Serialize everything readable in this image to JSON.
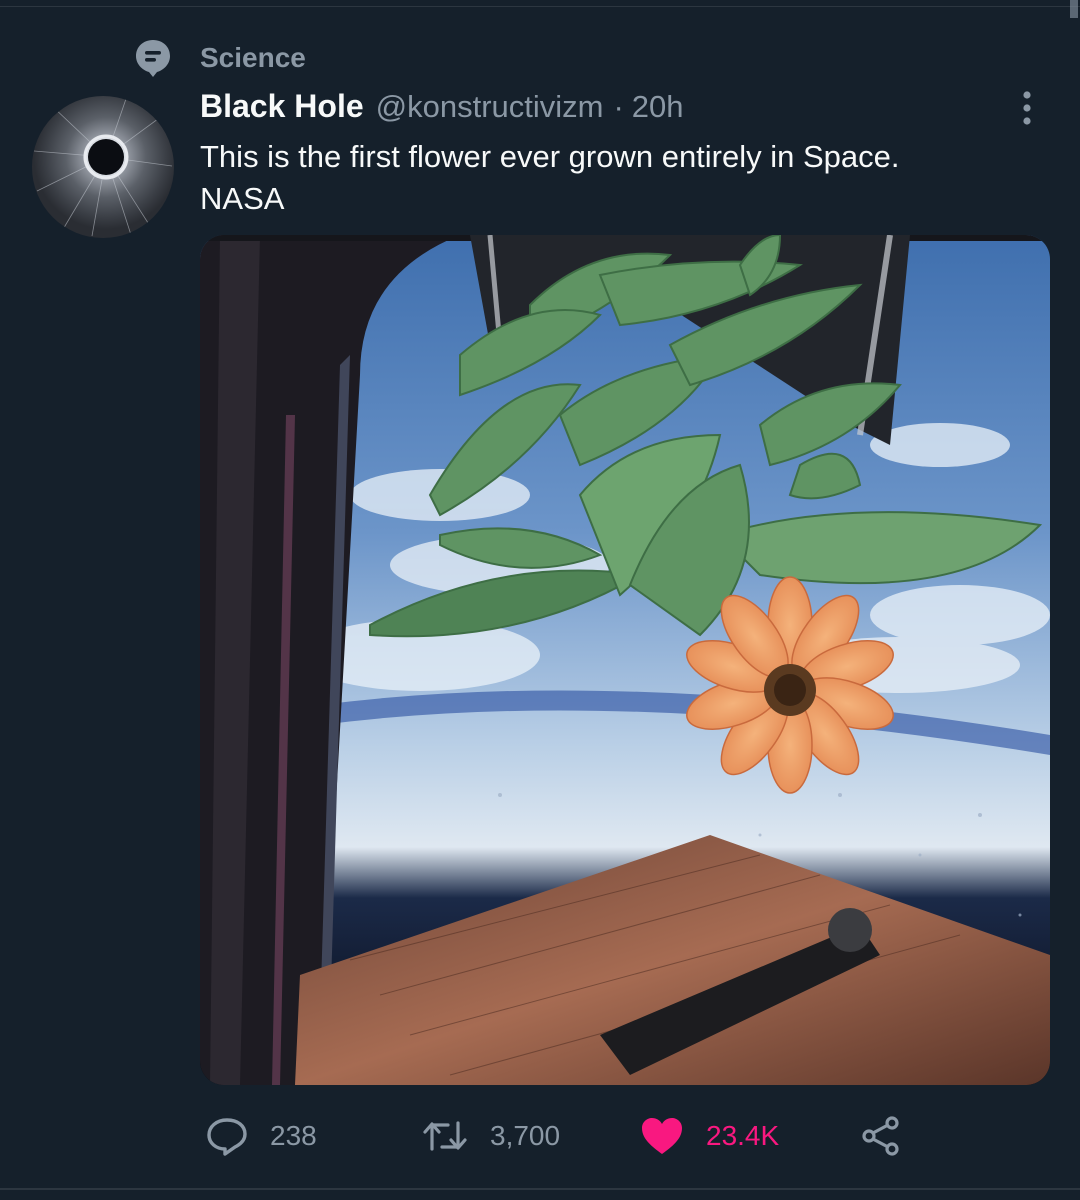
{
  "topic": {
    "label": "Science",
    "icon": "topic-bubble-icon"
  },
  "tweet": {
    "display_name": "Black Hole",
    "handle": "@konstructivizm",
    "separator": "·",
    "time": "20h",
    "text_line1": "This is the first flower ever grown entirely in Space.",
    "text_line2": "NASA"
  },
  "media": {
    "description_icon": "photo"
  },
  "actions": {
    "reply_count": "238",
    "retweet_count": "3,700",
    "like_count": "23.4K",
    "liked": true
  },
  "colors": {
    "background": "#15202b",
    "text_primary": "#f7f9f9",
    "text_secondary": "#8b98a5",
    "like": "#f91880"
  }
}
